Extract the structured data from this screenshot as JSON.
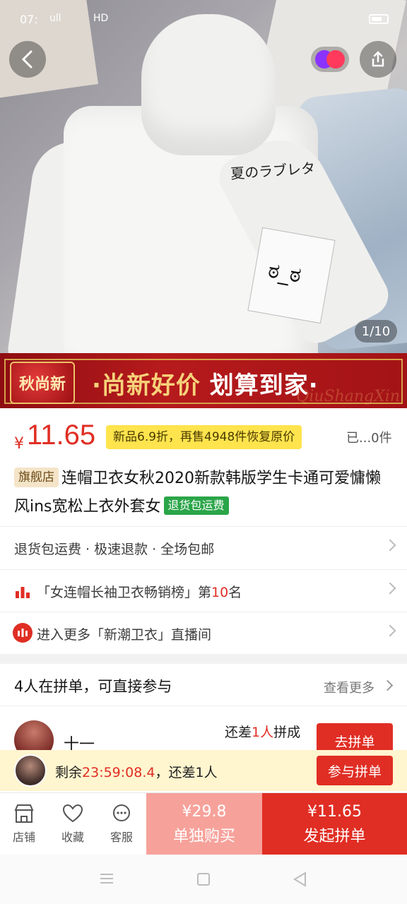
{
  "status_bar": {
    "time": "07:",
    "network": "ull",
    "hd": "HD"
  },
  "hero": {
    "print_text": "夏のラブレタ",
    "image_counter": "1/10"
  },
  "banner": {
    "tag": "秋尚新",
    "slogan_part1": "·尚新好价",
    "slogan_part2": "划算到家·",
    "watermark": "QiuShangXin"
  },
  "price": {
    "currency": "¥",
    "value": "11.65",
    "promo_text": "新品6.9折，再售4948件恢复原价",
    "sold": "已...0件"
  },
  "product": {
    "store_badge": "旗舰店",
    "title": "连帽卫衣女秋2020新款韩版学生卡通可爱慵懒风ins宽松上衣外套女",
    "return_badge": "退货包运费"
  },
  "services": {
    "text": "退货包运费 · 极速退款 · 全场包邮"
  },
  "ranking": {
    "prefix": "「女连帽长袖卫衣畅销榜」第",
    "rank": "10",
    "suffix": "名"
  },
  "live": {
    "icon_label": "播",
    "text": "进入更多「新潮卫衣」直播间"
  },
  "group_buy": {
    "header": "4人在拼单，可直接参与",
    "see_more": "查看更多",
    "row": {
      "user_name": "十一",
      "need_prefix": "还差",
      "need_count": "1人",
      "need_suffix": "拼成",
      "button": "去拼单"
    }
  },
  "join_bar": {
    "prefix": "剩余",
    "countdown": "23:59:08.4",
    "suffix": "，还差1人",
    "button": "参与拼单"
  },
  "bottom_bar": {
    "store": "店铺",
    "favorite": "收藏",
    "service": "客服",
    "alone_price": "¥29.8",
    "alone_label": "单独购买",
    "group_price": "¥11.65",
    "group_label": "发起拼单"
  },
  "colors": {
    "accent": "#e02e24",
    "promo_yellow": "#ffe44d",
    "buy_alone": "#f6a29b"
  }
}
